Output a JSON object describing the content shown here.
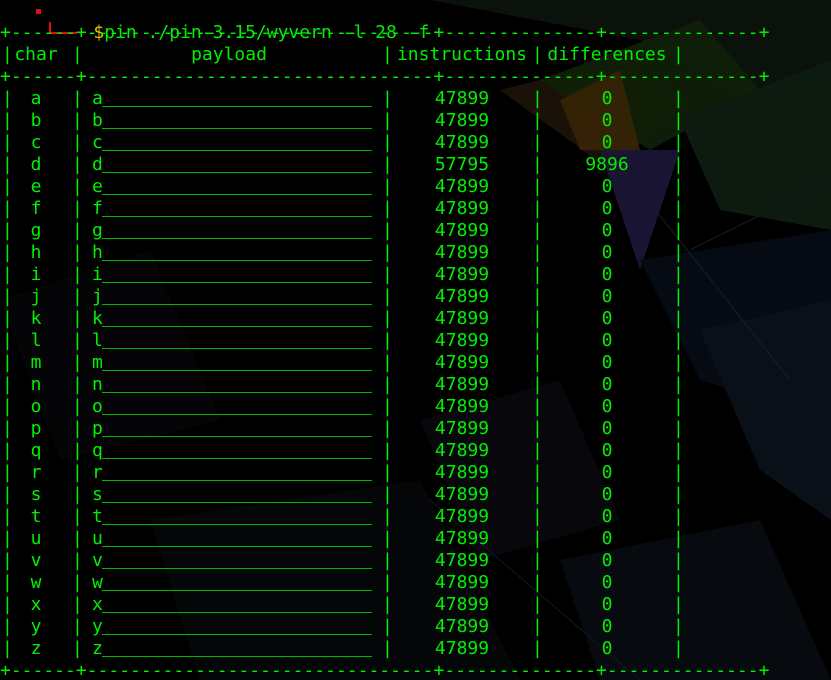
{
  "prompt": {
    "symbol": "$",
    "command": "pin ./pin-3.15/wyvern -l 28 -f"
  },
  "table": {
    "border": "+------+--------------------------------+--------------+--------------+",
    "headers": {
      "char": "char",
      "payload": "payload",
      "instructions": "instructions",
      "differences": "differences"
    },
    "rows": [
      {
        "char": "a",
        "payload": "a",
        "instructions": "47899",
        "differences": "0"
      },
      {
        "char": "b",
        "payload": "b",
        "instructions": "47899",
        "differences": "0"
      },
      {
        "char": "c",
        "payload": "c",
        "instructions": "47899",
        "differences": "0"
      },
      {
        "char": "d",
        "payload": "d",
        "instructions": "57795",
        "differences": "9896"
      },
      {
        "char": "e",
        "payload": "e",
        "instructions": "47899",
        "differences": "0"
      },
      {
        "char": "f",
        "payload": "f",
        "instructions": "47899",
        "differences": "0"
      },
      {
        "char": "g",
        "payload": "g",
        "instructions": "47899",
        "differences": "0"
      },
      {
        "char": "h",
        "payload": "h",
        "instructions": "47899",
        "differences": "0"
      },
      {
        "char": "i",
        "payload": "i",
        "instructions": "47899",
        "differences": "0"
      },
      {
        "char": "j",
        "payload": "j",
        "instructions": "47899",
        "differences": "0"
      },
      {
        "char": "k",
        "payload": "k",
        "instructions": "47899",
        "differences": "0"
      },
      {
        "char": "l",
        "payload": "l",
        "instructions": "47899",
        "differences": "0"
      },
      {
        "char": "m",
        "payload": "m",
        "instructions": "47899",
        "differences": "0"
      },
      {
        "char": "n",
        "payload": "n",
        "instructions": "47899",
        "differences": "0"
      },
      {
        "char": "o",
        "payload": "o",
        "instructions": "47899",
        "differences": "0"
      },
      {
        "char": "p",
        "payload": "p",
        "instructions": "47899",
        "differences": "0"
      },
      {
        "char": "q",
        "payload": "q",
        "instructions": "47899",
        "differences": "0"
      },
      {
        "char": "r",
        "payload": "r",
        "instructions": "47899",
        "differences": "0"
      },
      {
        "char": "s",
        "payload": "s",
        "instructions": "47899",
        "differences": "0"
      },
      {
        "char": "t",
        "payload": "t",
        "instructions": "47899",
        "differences": "0"
      },
      {
        "char": "u",
        "payload": "u",
        "instructions": "47899",
        "differences": "0"
      },
      {
        "char": "v",
        "payload": "v",
        "instructions": "47899",
        "differences": "0"
      },
      {
        "char": "w",
        "payload": "w",
        "instructions": "47899",
        "differences": "0"
      },
      {
        "char": "x",
        "payload": "x",
        "instructions": "47899",
        "differences": "0"
      },
      {
        "char": "y",
        "payload": "y",
        "instructions": "47899",
        "differences": "0"
      },
      {
        "char": "z",
        "payload": "z",
        "instructions": "47899",
        "differences": "0"
      }
    ]
  },
  "colors": {
    "text": "#00f000",
    "prompt_symbol": "#e8c900",
    "prompt_corner": "#dd1111",
    "background": "#000000"
  }
}
